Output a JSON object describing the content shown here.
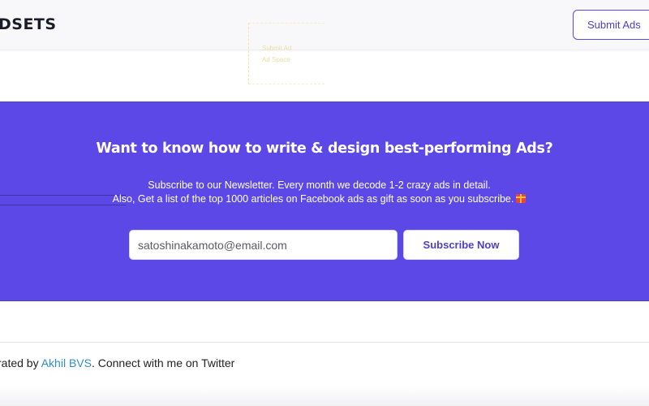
{
  "header": {
    "brand": "DSETS",
    "submit_label": "Submit Ads"
  },
  "ad_placeholder": {
    "line1": "Submit Ad",
    "line2": "Ad Space"
  },
  "newsletter": {
    "title": "Want to know how to write & design best-performing Ads?",
    "line1": "Subscribe to our Newsletter. Every month we decode 1-2 crazy ads in detail.",
    "line2": "Also, Get a list of the top 1000 articles on Facebook ads as gift as soon as you subscribe.",
    "email_placeholder": "satoshinakamoto@email.com",
    "subscribe_label": "Subscribe Now",
    "gift_icon": "wrapped-gift"
  },
  "footer": {
    "prefix": "rated by ",
    "author": "Akhil BVS",
    "suffix": ". Connect with me on Twitter",
    "link_color": "#2f8fc4"
  },
  "colors": {
    "accent": "#5c48e6",
    "button_text": "#4c3fc9"
  }
}
